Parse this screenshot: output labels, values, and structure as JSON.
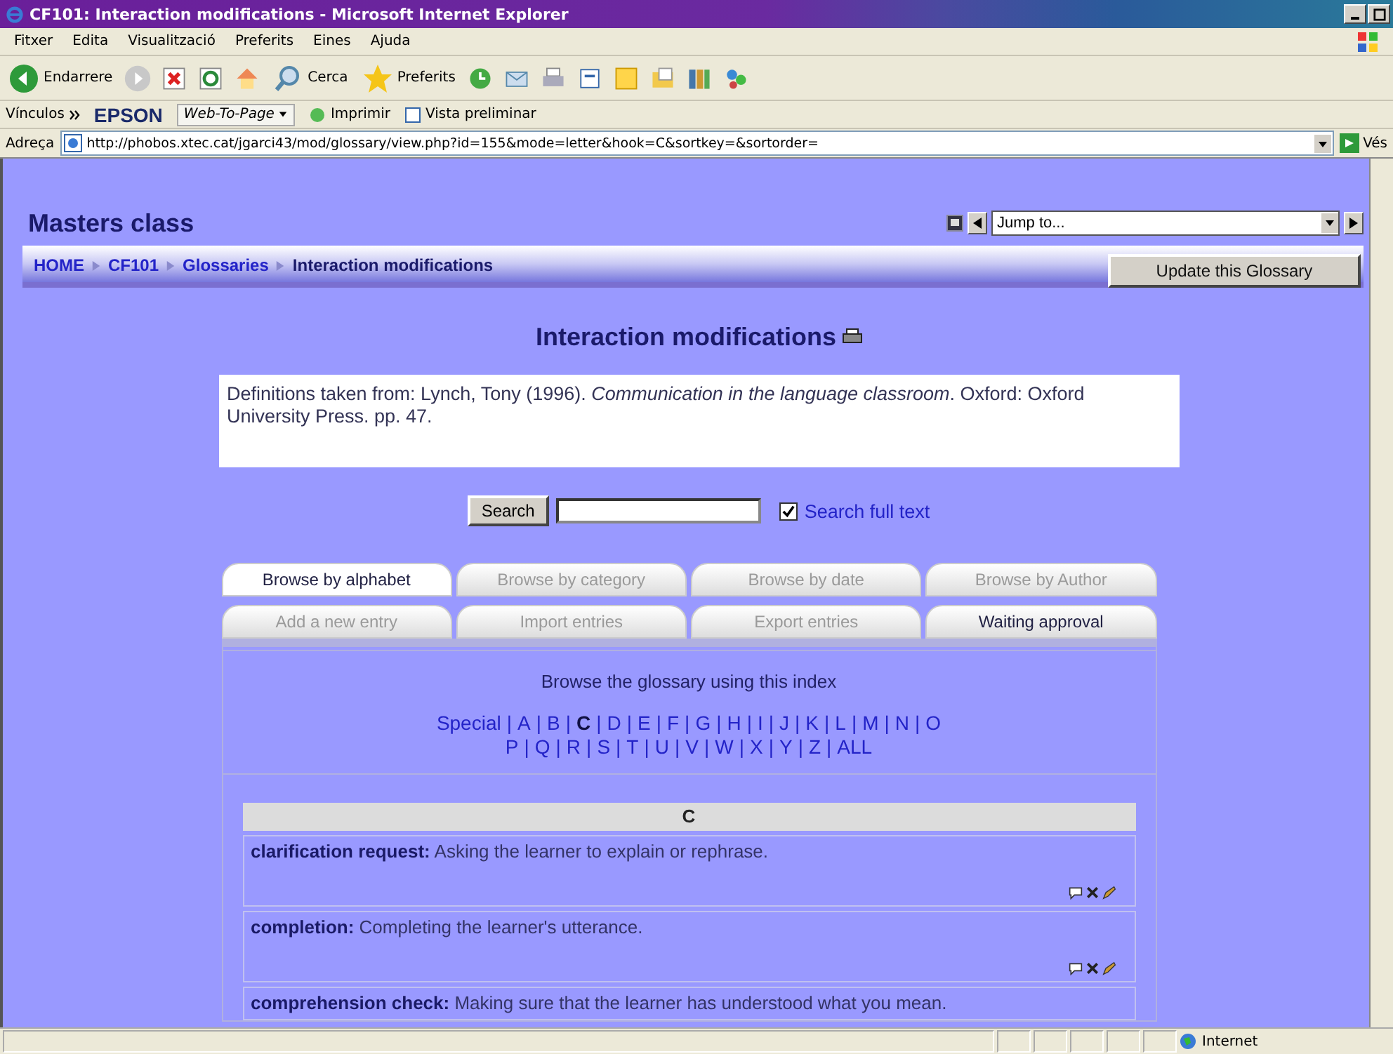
{
  "window": {
    "title": "CF101: Interaction modifications - Microsoft Internet Explorer"
  },
  "menu": [
    "Fitxer",
    "Edita",
    "Visualització",
    "Preferits",
    "Eines",
    "Ajuda"
  ],
  "toolbar": {
    "back": "Endarrere",
    "search": "Cerca",
    "favorites": "Preferits"
  },
  "links_bar": {
    "label": "Vínculos",
    "epson": "EPSON",
    "web_to_page": "Web-To-Page",
    "print": "Imprimir",
    "preview": "Vista preliminar"
  },
  "address": {
    "label": "Adreça",
    "value": "http://phobos.xtec.cat/jgarci43/mod/glossary/view.php?id=155&mode=letter&hook=C&sortkey=&sortorder=",
    "go": "Vés"
  },
  "page": {
    "site_name": "Masters class",
    "jump_to": "Jump to...",
    "breadcrumb": [
      "HOME",
      "CF101",
      "Glossaries",
      "Interaction modifications"
    ],
    "update_button": "Update this Glossary",
    "heading": "Interaction modifications",
    "intro": "Definitions taken from: Lynch, Tony (1996). *Communication in the language classroom*. Oxford: Oxford University Press. pp. 47.",
    "search": {
      "button": "Search",
      "full_text_checked": true,
      "full_text_label": "Search full text"
    },
    "tabs": [
      {
        "label": "Browse by alphabet",
        "selected": true,
        "dimmed": false
      },
      {
        "label": "Browse by category",
        "selected": false,
        "dimmed": true
      },
      {
        "label": "Browse by date",
        "selected": false,
        "dimmed": true
      },
      {
        "label": "Browse by Author",
        "selected": false,
        "dimmed": true
      }
    ],
    "action_tabs": [
      {
        "label": "Add a new entry",
        "dimmed": true
      },
      {
        "label": "Import entries",
        "dimmed": true
      },
      {
        "label": "Export entries",
        "dimmed": true
      },
      {
        "label": "Waiting approval",
        "dimmed": false
      }
    ],
    "index_caption": "Browse the glossary using this index",
    "letter_separator": "|",
    "letters_rows": [
      [
        {
          "label": "Special",
          "selected": false
        },
        {
          "label": "A",
          "selected": false
        },
        {
          "label": "B",
          "selected": false
        },
        {
          "label": "C",
          "selected": true
        },
        {
          "label": "D",
          "selected": false
        },
        {
          "label": "E",
          "selected": false
        },
        {
          "label": "F",
          "selected": false
        },
        {
          "label": "G",
          "selected": false
        },
        {
          "label": "H",
          "selected": false
        },
        {
          "label": "I",
          "selected": false
        },
        {
          "label": "J",
          "selected": false
        },
        {
          "label": "K",
          "selected": false
        },
        {
          "label": "L",
          "selected": false
        },
        {
          "label": "M",
          "selected": false
        },
        {
          "label": "N",
          "selected": false
        },
        {
          "label": "O",
          "selected": false
        }
      ],
      [
        {
          "label": "P",
          "selected": false
        },
        {
          "label": "Q",
          "selected": false
        },
        {
          "label": "R",
          "selected": false
        },
        {
          "label": "S",
          "selected": false
        },
        {
          "label": "T",
          "selected": false
        },
        {
          "label": "U",
          "selected": false
        },
        {
          "label": "V",
          "selected": false
        },
        {
          "label": "W",
          "selected": false
        },
        {
          "label": "X",
          "selected": false
        },
        {
          "label": "Y",
          "selected": false
        },
        {
          "label": "Z",
          "selected": false
        },
        {
          "label": "ALL",
          "selected": false
        }
      ]
    ],
    "section_letter": "C",
    "entries": [
      {
        "term": "clarification request:",
        "definition": "Asking the learner to explain or rephrase.",
        "show_actions": true
      },
      {
        "term": "completion:",
        "definition": "Completing the learner's utterance.",
        "show_actions": true
      },
      {
        "term": "comprehension check:",
        "definition": "Making sure that the learner has understood what you mean.",
        "show_actions": false
      }
    ]
  },
  "status_bar": {
    "zone": "Internet"
  }
}
